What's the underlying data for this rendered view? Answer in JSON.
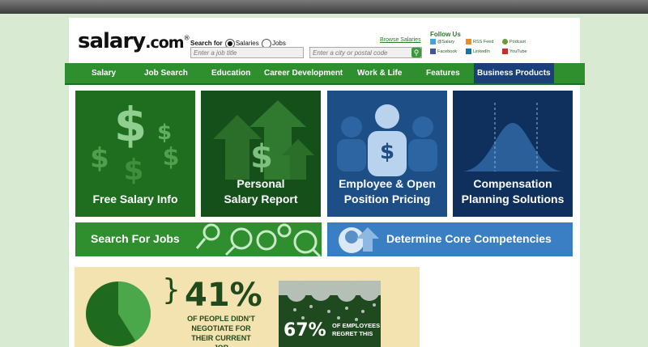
{
  "header": {
    "logo_main": "salary",
    "logo_tld": ".com",
    "logo_mark": "®",
    "search_for_label": "Search for",
    "radio_salaries": "Salaries",
    "radio_jobs": "Jobs",
    "job_title_placeholder": "Enter a job title",
    "location_placeholder": "Enter a city or postal code",
    "browse_salaries": "Browse Salaries",
    "follow_us": "Follow Us",
    "social": {
      "twitter": "@Salary",
      "rss": "RSS Feed",
      "podcast": "Podcast",
      "facebook": "Facebook",
      "linkedin": "LinkedIn",
      "youtube": "YouTube"
    }
  },
  "nav": {
    "items": [
      "Salary",
      "Job Search",
      "Education",
      "Career Development",
      "Work & Life",
      "Features",
      "Business Products"
    ],
    "active": "Business Products"
  },
  "tiles": [
    {
      "line1": "Free Salary Info",
      "line2": ""
    },
    {
      "line1": "Personal",
      "line2": "Salary Report"
    },
    {
      "line1": "Employee & Open",
      "line2": "Position Pricing"
    },
    {
      "line1": "Compensation",
      "line2": "Planning Solutions"
    }
  ],
  "bars": {
    "jobs": "Search For Jobs",
    "competencies": "Determine Core Competencies"
  },
  "infographic": {
    "stat1_value": "41%",
    "stat1_line1": "OF PEOPLE DIDN'T",
    "stat1_line2": "NEGOTIATE FOR",
    "stat1_line3": "THEIR CURRENT JOB",
    "stat2_value": "67%",
    "stat2_line1": "OF EMPLOYEES",
    "stat2_line2": "REGRET THIS",
    "pie_percent": 41
  },
  "colors": {
    "brand_green": "#2f8f2f",
    "active_nav": "#1a3f7a",
    "tile_green": "#1f6e1f",
    "tile_blue": "#1d4f86",
    "bar_blue": "#3a7fc4"
  }
}
